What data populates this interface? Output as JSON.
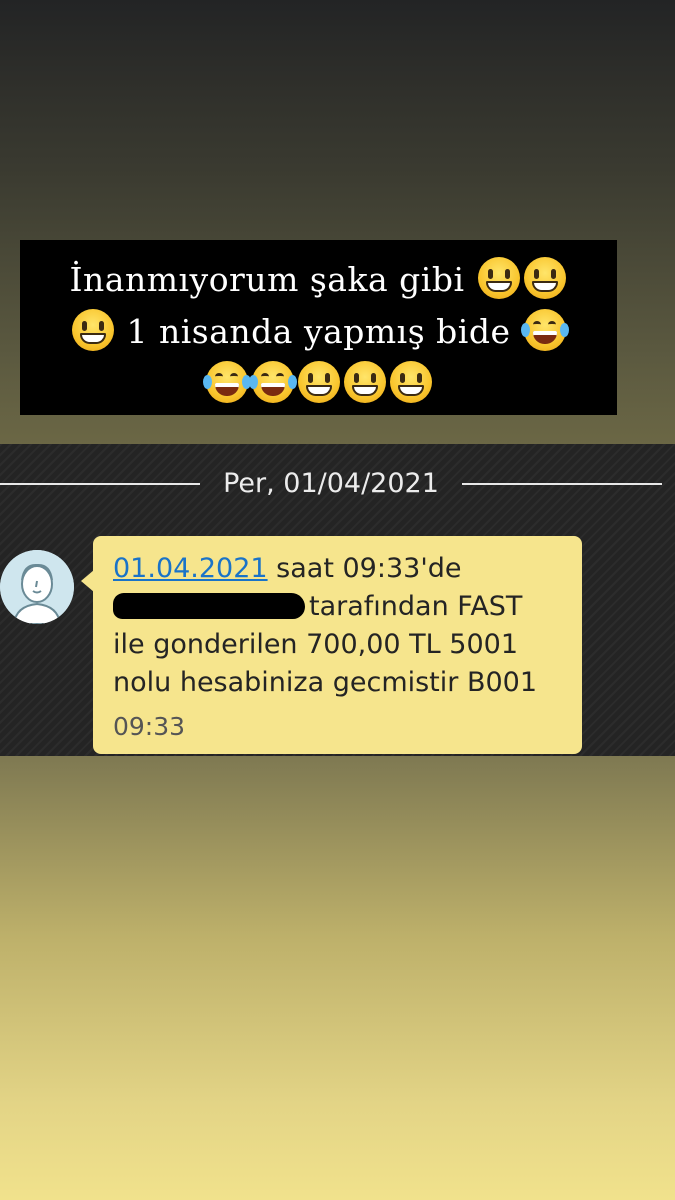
{
  "caption": {
    "line1_text": "İnanmıyorum şaka gibi",
    "line2_text": "1 nisanda yapmış bide",
    "line1_emojis": [
      "grinning-sweat-icon",
      "grinning-sweat-icon"
    ],
    "line2_lead_emoji": "grinning-sweat-icon",
    "line2_trail_emoji": "tears-of-joy-icon",
    "line3_emojis": [
      "tears-of-joy-icon",
      "tears-of-joy-icon",
      "grinning-sweat-icon",
      "grinning-sweat-icon",
      "grinning-sweat-icon"
    ]
  },
  "chat": {
    "date_separator": "Per, 01/04/2021",
    "message": {
      "date_link": "01.04.2021",
      "line1_rest": " saat 09:33'de",
      "line2_rest": "tarafından FAST",
      "line3": "ile gonderilen 700,00 TL 5001",
      "line4": "nolu hesabiniza gecmistir B001",
      "time": "09:33"
    }
  },
  "colors": {
    "bubble": "#f6e58d",
    "link": "#1a73c8",
    "chat_bg": "#242424",
    "caption_bg": "#000000"
  }
}
